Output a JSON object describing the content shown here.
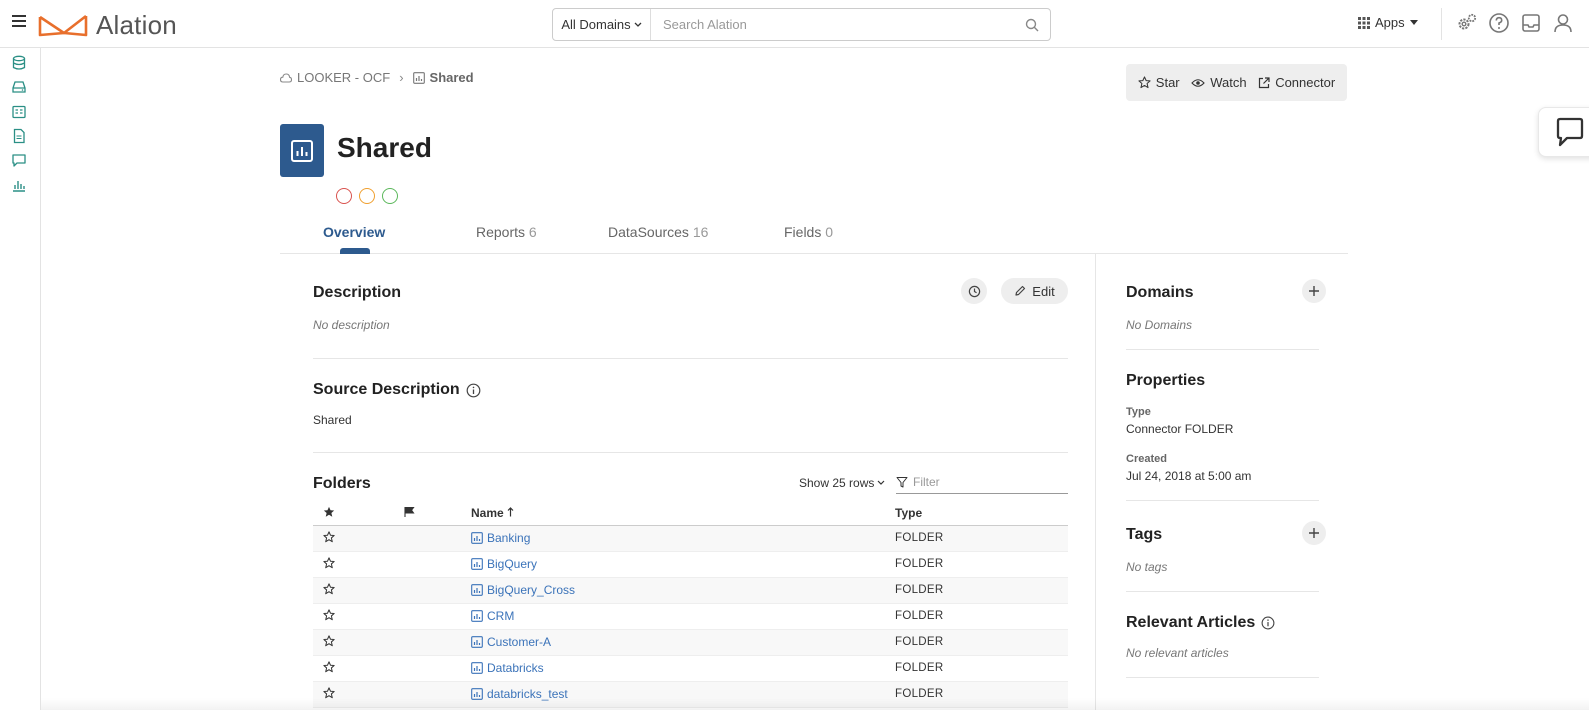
{
  "topbar": {
    "logo_text": "Alation",
    "search_domains": "All Domains",
    "search_placeholder": "Search Alation",
    "apps_label": "Apps"
  },
  "breadcrumb": {
    "source": "LOOKER - OCF",
    "current": "Shared"
  },
  "actions": {
    "star": "Star",
    "watch": "Watch",
    "connector": "Connector"
  },
  "object": {
    "title": "Shared",
    "icon_color": "#2d5a8e",
    "trust_colors": [
      "#d9534f",
      "#f0a030",
      "#5cb85c"
    ]
  },
  "tabs": [
    {
      "label": "Overview",
      "count": ""
    },
    {
      "label": "Reports",
      "count": "6"
    },
    {
      "label": "DataSources",
      "count": "16"
    },
    {
      "label": "Fields",
      "count": "0"
    }
  ],
  "description": {
    "title": "Description",
    "empty": "No description",
    "edit_label": "Edit"
  },
  "source_description": {
    "title": "Source Description",
    "value": "Shared"
  },
  "folders": {
    "title": "Folders",
    "show_rows": "Show 25 rows",
    "filter_placeholder": "Filter",
    "headers": {
      "name": "Name",
      "type": "Type"
    },
    "rows": [
      {
        "name": "Banking",
        "type": "FOLDER"
      },
      {
        "name": "BigQuery",
        "type": "FOLDER"
      },
      {
        "name": "BigQuery_Cross",
        "type": "FOLDER"
      },
      {
        "name": "CRM",
        "type": "FOLDER"
      },
      {
        "name": "Customer-A",
        "type": "FOLDER"
      },
      {
        "name": "Databricks",
        "type": "FOLDER"
      },
      {
        "name": "databricks_test",
        "type": "FOLDER"
      }
    ]
  },
  "sidebar": {
    "domains": {
      "title": "Domains",
      "empty": "No Domains"
    },
    "properties": {
      "title": "Properties",
      "type_label": "Type",
      "type_value": "Connector FOLDER",
      "created_label": "Created",
      "created_value": "Jul 24, 2018 at 5:00 am"
    },
    "tags": {
      "title": "Tags",
      "empty": "No tags"
    },
    "articles": {
      "title": "Relevant Articles",
      "empty": "No relevant articles"
    }
  },
  "colors": {
    "accent": "#2d5a8e",
    "link": "#3b73b9",
    "logo": "#e86f2c",
    "rail_icons": "#2a8f85"
  }
}
